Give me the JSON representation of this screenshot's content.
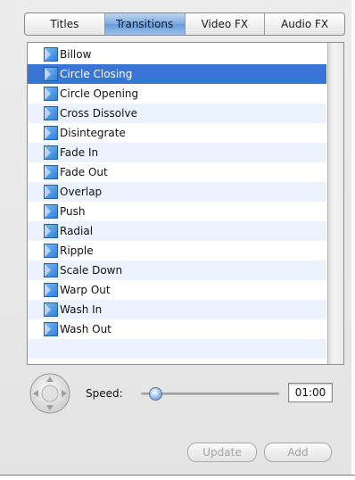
{
  "tabs": [
    {
      "label": "Titles",
      "active": false
    },
    {
      "label": "Transitions",
      "active": true
    },
    {
      "label": "Video FX",
      "active": false
    },
    {
      "label": "Audio FX",
      "active": false
    }
  ],
  "transitions": [
    {
      "label": "Billow",
      "selected": false
    },
    {
      "label": "Circle Closing",
      "selected": true
    },
    {
      "label": "Circle Opening",
      "selected": false
    },
    {
      "label": "Cross Dissolve",
      "selected": false
    },
    {
      "label": "Disintegrate",
      "selected": false
    },
    {
      "label": "Fade In",
      "selected": false
    },
    {
      "label": "Fade Out",
      "selected": false
    },
    {
      "label": "Overlap",
      "selected": false
    },
    {
      "label": "Push",
      "selected": false
    },
    {
      "label": "Radial",
      "selected": false
    },
    {
      "label": "Ripple",
      "selected": false
    },
    {
      "label": "Scale Down",
      "selected": false
    },
    {
      "label": "Warp Out",
      "selected": false
    },
    {
      "label": "Wash In",
      "selected": false
    },
    {
      "label": "Wash Out",
      "selected": false
    }
  ],
  "controls": {
    "speed_label": "Speed:",
    "speed_value": 0.1,
    "time_value": "01:00",
    "update_label": "Update",
    "add_label": "Add"
  },
  "colors": {
    "selection": "#3875d7",
    "row_alt": "#edf3fe",
    "icon_blue": "#3a8be0"
  }
}
